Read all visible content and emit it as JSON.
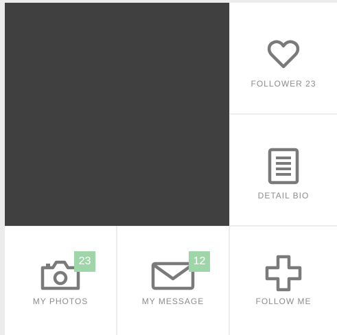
{
  "profile": {
    "cover_placeholder": ""
  },
  "tiles": {
    "follower": {
      "label": "FOLLOWER 23",
      "icon": "heart-icon"
    },
    "detail_bio": {
      "label": "DETAIL BIO",
      "icon": "document-icon"
    },
    "my_photos": {
      "label": "MY PHOTOS",
      "icon": "camera-icon",
      "badge": "23"
    },
    "my_message": {
      "label": "MY MESSAGE",
      "icon": "envelope-icon",
      "badge": "12"
    },
    "follow_me": {
      "label": "FOLLOW ME",
      "icon": "plus-icon"
    }
  },
  "colors": {
    "cover": "#404040",
    "badge": "#9ed6a9",
    "icon": "#7a7a7a",
    "label": "#8c8c8c"
  }
}
